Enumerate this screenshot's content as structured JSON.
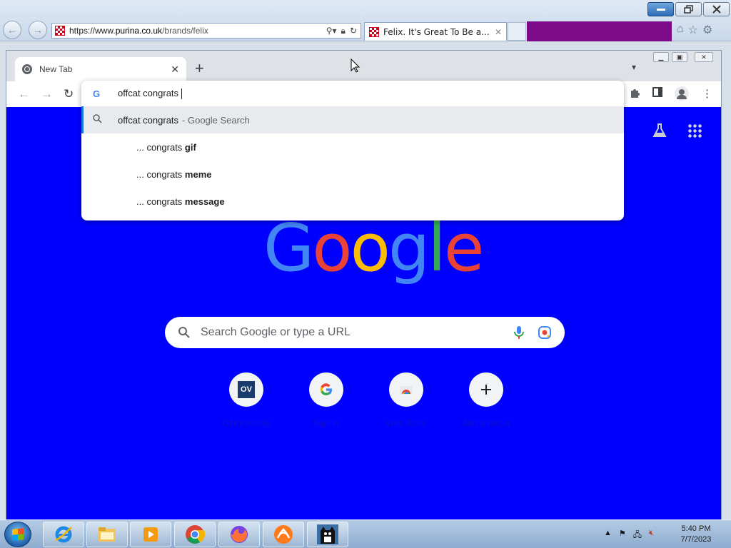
{
  "ie": {
    "url_prefix": "https://www.",
    "url_host": "purina.co.uk",
    "url_rest": "/brands/felix",
    "tab_title": "Felix. It's Great To Be a..."
  },
  "chrome": {
    "tab_title": "New Tab",
    "omnibox": {
      "value": "offcat congrats",
      "suggestions": [
        {
          "main": "offcat congrats",
          "sub": "- Google Search"
        },
        {
          "prefix": "... congrats ",
          "bold": "gif"
        },
        {
          "prefix": "... congrats ",
          "bold": "meme"
        },
        {
          "prefix": "... congrats ",
          "bold": "message"
        }
      ]
    },
    "ntp": {
      "search_placeholder": "Search Google or type a URL",
      "tiles": [
        {
          "label": "OfficeVersity",
          "icon": "ov-icon",
          "glyph": "OV"
        },
        {
          "label": "Sign in",
          "icon": "google-icon"
        },
        {
          "label": "Web Store",
          "icon": "webstore-icon"
        },
        {
          "label": "Add shortcut",
          "icon": "plus-icon"
        }
      ]
    },
    "colors": {
      "ntp_background": "#0000ff",
      "accent": "#1a73e8"
    }
  },
  "taskbar": {
    "clock_time": "5:40 PM",
    "clock_date": "7/7/2023",
    "apps": [
      "internet-explorer",
      "file-explorer",
      "media-player",
      "chrome",
      "firefox",
      "vlc-like-app",
      "felix-cat-app"
    ]
  }
}
